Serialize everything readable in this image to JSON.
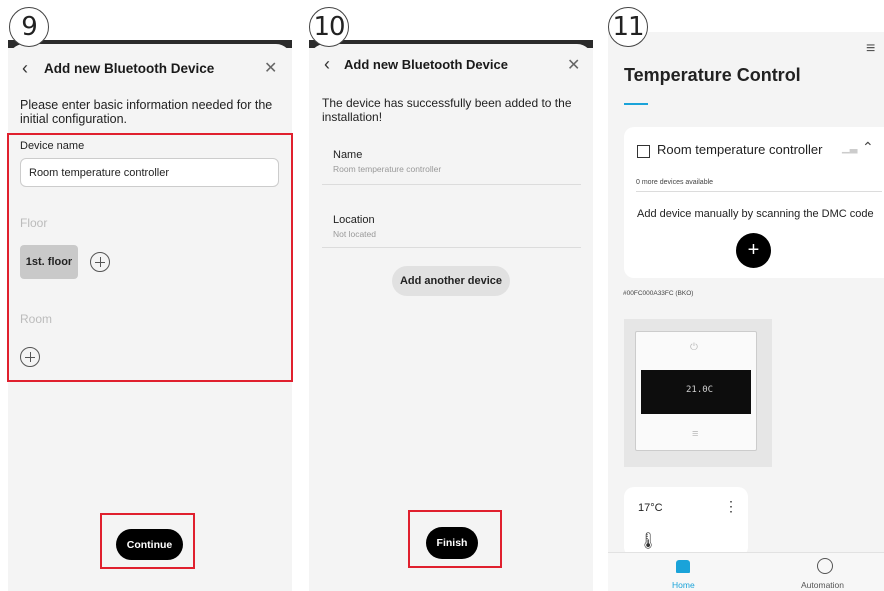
{
  "steps": [
    "9",
    "10",
    "11"
  ],
  "screen1": {
    "title": "Add new Bluetooth Device",
    "intro": "Please enter basic information needed for the initial configuration.",
    "device_name_label": "Device name",
    "device_name_value": "Room temperature controller",
    "floor_label": "Floor",
    "floor_chip": "1st. floor",
    "room_label": "Room",
    "continue_label": "Continue"
  },
  "screen2": {
    "title": "Add new Bluetooth Device",
    "success_text": "The device has successfully been added to the installation!",
    "name_label": "Name",
    "name_value": "Room temperature controller",
    "location_label": "Location",
    "location_value": "Not located",
    "add_another_label": "Add another device",
    "finish_label": "Finish"
  },
  "screen3": {
    "title": "Temperature Control",
    "device_title": "Room temperature controller",
    "more_devices": "0 more devices available",
    "add_manually": "Add device manually by scanning the DMC code",
    "device_id": "#00FC000A33FC (BKO)",
    "display_temp": "21.0C",
    "tile_temp": "17°C",
    "nav_home": "Home",
    "nav_automation": "Automation"
  },
  "colors": {
    "highlight": "#e0202e",
    "accent": "#1aa3d9"
  }
}
